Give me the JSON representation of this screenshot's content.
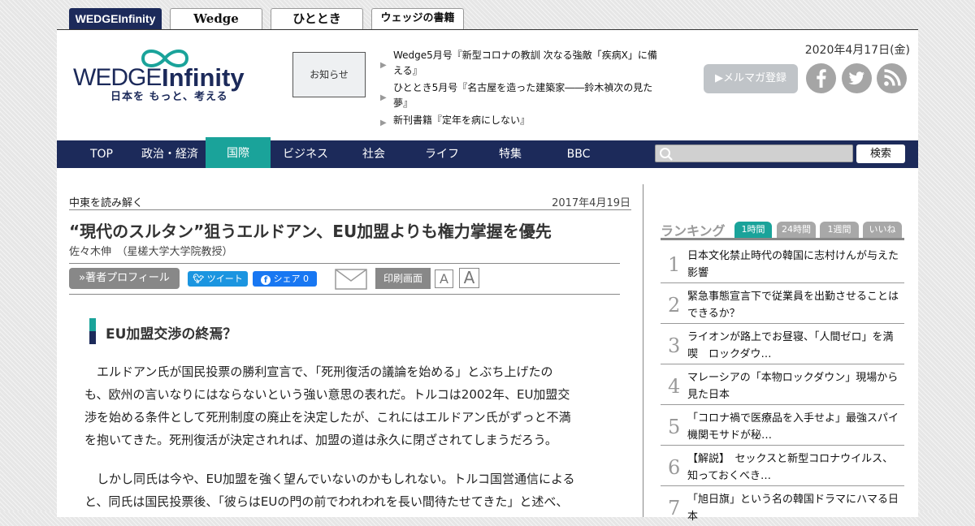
{
  "site_tabs": [
    {
      "label_main": "WEDGE",
      "label_accent": "Infinity"
    },
    {
      "label": "Wedge"
    },
    {
      "label": "ひととき"
    },
    {
      "label": "ウェッジの書籍"
    }
  ],
  "header": {
    "logo_main": "WEDGE",
    "logo_accent": "Infinity",
    "logo_tagline": "日本を もっと、考える",
    "notice_label": "お知らせ",
    "news": [
      "Wedge5月号『新型コロナの教訓 次なる強敵「疾病X」に備える』",
      "ひととき5月号『名古屋を造った建築家――鈴木禎次の見た夢』",
      "新刊書籍『定年を病にしない』"
    ],
    "date": "2020年4月17日(金)",
    "mailmag_label": "▶メルマガ登録",
    "social_icons": [
      "facebook-icon",
      "twitter-icon",
      "rss-icon"
    ]
  },
  "nav": {
    "items": [
      "TOP",
      "政治・経済",
      "国際",
      "ビジネス",
      "社会",
      "ライフ",
      "特集",
      "BBC"
    ],
    "active_index": 2,
    "search_button": "検索"
  },
  "article": {
    "breadcrumb": "中東を読み解く",
    "date": "2017年4月19日",
    "title": "“現代のスルタン”狙うエルドアン、EU加盟よりも権力掌握を優先",
    "author": "佐々木伸　（星槎大学大学院教授）",
    "profile_button": "»著者プロフィール",
    "tweet_button": "ツイート",
    "share_button": "シェア 0",
    "print_button": "印刷画面",
    "font_small": "A",
    "font_large": "A",
    "section_heading": "EU加盟交渉の終焉？",
    "paragraphs": [
      [
        "　エルドアン氏が国民投票の勝利宣言で、「死刑復活の議論を始める」とぶち上げたの",
        "も、欧州の言いなりにはならないという強い意思の表れだ。トルコは2002年、EU加盟交",
        "渉を始める条件として死刑制度の廃止を決定したが、これにはエルドアン氏がずっと不満",
        "を抱いてきた。死刑復活が決定されれば、加盟の道は永久に閉ざされてしまうだろう。"
      ],
      [
        "　しかし同氏は今や、EU加盟を強く望んでいないのかもしれない。トルコ国営通信による",
        "と、同氏は国民投票後、「彼らはEUの門の前でわれわれを長い間待たせてきた」と述べ、"
      ]
    ],
    "accent_colors": {
      "navy": "#1c2a5a",
      "teal": "#1aa39a"
    }
  },
  "ranking": {
    "title": "ランキング",
    "tabs": [
      "1時間",
      "24時間",
      "1週間",
      "いいね"
    ],
    "active_tab": 0,
    "items": [
      {
        "rank": "1",
        "text": "日本文化禁止時代の韓国に志村けんが与えた影響"
      },
      {
        "rank": "2",
        "text": "緊急事態宣言下で従業員を出勤させることはできるか？"
      },
      {
        "rank": "3",
        "text": "ライオンが路上でお昼寝、「人間ゼロ」を満喫　ロックダウ…"
      },
      {
        "rank": "4",
        "text": "マレーシアの「本物ロックダウン」現場から見た日本"
      },
      {
        "rank": "5",
        "text": "「コロナ禍で医療品を入手せよ」最強スパイ機関モサドが秘…"
      },
      {
        "rank": "6",
        "text": "【解説】　セックスと新型コロナウイルス、知っておくべき…"
      },
      {
        "rank": "7",
        "text": "「旭日旗」という名の韓国ドラマにハマる日本"
      }
    ]
  }
}
